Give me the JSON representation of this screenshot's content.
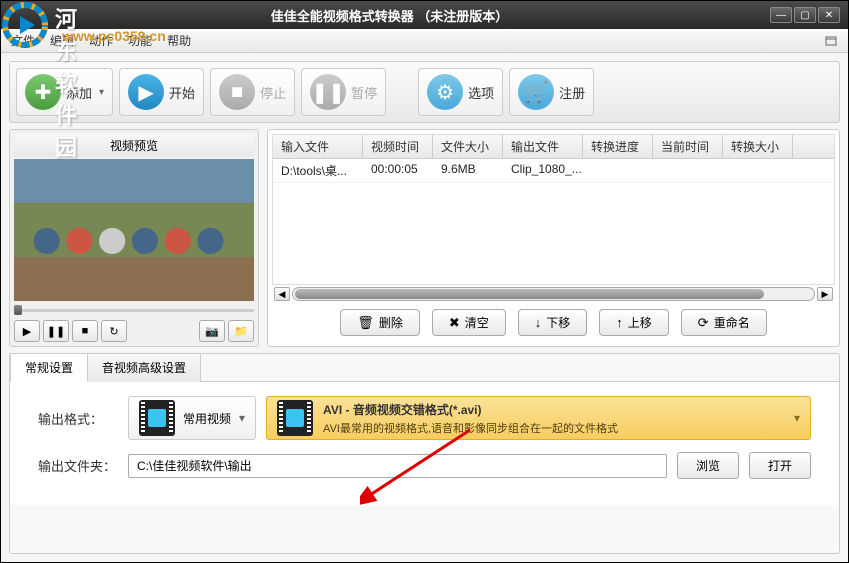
{
  "watermark": {
    "text": "河东软件园",
    "url": "www.pc0359.cn"
  },
  "window": {
    "title": "佳佳全能视频格式转换器 （未注册版本）"
  },
  "menu": {
    "file": "文件",
    "edit": "编辑",
    "action": "动作",
    "function": "功能",
    "help": "帮助"
  },
  "toolbar": {
    "add": "添加",
    "start": "开始",
    "stop": "停止",
    "pause": "暂停",
    "options": "选项",
    "register": "注册"
  },
  "preview": {
    "title": "视频预览"
  },
  "table": {
    "headers": [
      "输入文件",
      "视频时间",
      "文件大小",
      "输出文件",
      "转换进度",
      "当前时间",
      "转换大小"
    ],
    "rows": [
      {
        "input": "D:\\tools\\桌...",
        "time": "00:00:05",
        "size": "9.6MB",
        "output": "Clip_1080_...",
        "progress": "",
        "curtime": "",
        "cursize": ""
      }
    ]
  },
  "actions": {
    "delete": "删除",
    "clear": "清空",
    "down": "下移",
    "up": "上移",
    "rename": "重命名"
  },
  "tabs": {
    "basic": "常规设置",
    "advanced": "音视频高级设置"
  },
  "output": {
    "format_label": "输出格式：",
    "format_category": "常用视频",
    "format_title": "AVI - 音频视频交错格式(*.avi)",
    "format_desc": "AVI最常用的视频格式,语音和影像同步组合在一起的文件格式",
    "folder_label": "输出文件夹：",
    "folder_path": "C:\\佳佳视频软件\\输出",
    "browse": "浏览",
    "open": "打开"
  }
}
